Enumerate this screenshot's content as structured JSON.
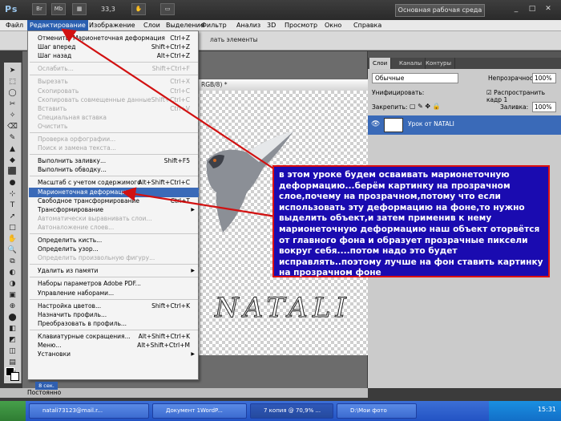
{
  "app": {
    "logo": "Ps",
    "zoom": "33,3",
    "workspace": "Основная рабочая среда"
  },
  "menubar": [
    {
      "label": "Файл",
      "active": false
    },
    {
      "label": "Редактирование",
      "active": true
    },
    {
      "label": "Изображение",
      "active": false
    },
    {
      "label": "Слои",
      "active": false
    },
    {
      "label": "Выделение",
      "active": false
    },
    {
      "label": "Фильтр",
      "active": false
    },
    {
      "label": "Анализ",
      "active": false
    },
    {
      "label": "3D",
      "active": false
    },
    {
      "label": "Просмотр",
      "active": false
    },
    {
      "label": "Окно",
      "active": false
    },
    {
      "label": "Справка",
      "active": false
    }
  ],
  "options": {
    "text": "лать элементы"
  },
  "edit_menu": [
    {
      "label": "Отменить: Марионеточная деформация",
      "shortcut": "Ctrl+Z",
      "state": "normal"
    },
    {
      "label": "Шаг вперед",
      "shortcut": "Shift+Ctrl+Z",
      "state": "normal"
    },
    {
      "label": "Шаг назад",
      "shortcut": "Alt+Ctrl+Z",
      "state": "normal"
    },
    {
      "sep": true
    },
    {
      "label": "Ослабить...",
      "shortcut": "Shift+Ctrl+F",
      "state": "disabled"
    },
    {
      "sep": true
    },
    {
      "label": "Вырезать",
      "shortcut": "Ctrl+X",
      "state": "disabled"
    },
    {
      "label": "Скопировать",
      "shortcut": "Ctrl+C",
      "state": "disabled"
    },
    {
      "label": "Скопировать совмещенные данные",
      "shortcut": "Shift+Ctrl+C",
      "state": "disabled"
    },
    {
      "label": "Вставить",
      "shortcut": "Ctrl+V",
      "state": "disabled"
    },
    {
      "label": "Специальная вставка",
      "shortcut": "",
      "state": "disabled"
    },
    {
      "label": "Очистить",
      "shortcut": "",
      "state": "disabled"
    },
    {
      "sep": true
    },
    {
      "label": "Проверка орфографии...",
      "shortcut": "",
      "state": "disabled"
    },
    {
      "label": "Поиск и замена текста...",
      "shortcut": "",
      "state": "disabled"
    },
    {
      "sep": true
    },
    {
      "label": "Выполнить заливку...",
      "shortcut": "Shift+F5",
      "state": "normal"
    },
    {
      "label": "Выполнить обводку...",
      "shortcut": "",
      "state": "normal"
    },
    {
      "sep": true
    },
    {
      "label": "Масштаб с учетом содержимого",
      "shortcut": "Alt+Shift+Ctrl+C",
      "state": "normal"
    },
    {
      "label": "Марионеточная деформация",
      "shortcut": "",
      "state": "highlighted"
    },
    {
      "label": "Свободное трансформирование",
      "shortcut": "Ctrl+T",
      "state": "normal"
    },
    {
      "label": "Трансформирование",
      "shortcut": "",
      "state": "normal",
      "submenu": true
    },
    {
      "label": "Автоматически выравнивать слои...",
      "shortcut": "",
      "state": "disabled"
    },
    {
      "label": "Автоналожение слоев...",
      "shortcut": "",
      "state": "disabled"
    },
    {
      "sep": true
    },
    {
      "label": "Определить кисть...",
      "shortcut": "",
      "state": "normal"
    },
    {
      "label": "Определить узор...",
      "shortcut": "",
      "state": "normal"
    },
    {
      "label": "Определить произвольную фигуру...",
      "shortcut": "",
      "state": "disabled"
    },
    {
      "sep": true
    },
    {
      "label": "Удалить из памяти",
      "shortcut": "",
      "state": "normal",
      "submenu": true
    },
    {
      "sep": true
    },
    {
      "label": "Наборы параметров Adobe PDF...",
      "shortcut": "",
      "state": "normal"
    },
    {
      "label": "Управление наборами...",
      "shortcut": "",
      "state": "normal"
    },
    {
      "sep": true
    },
    {
      "label": "Настройка цветов...",
      "shortcut": "Shift+Ctrl+K",
      "state": "normal"
    },
    {
      "label": "Назначить профиль...",
      "shortcut": "",
      "state": "normal"
    },
    {
      "label": "Преобразовать в профиль...",
      "shortcut": "",
      "state": "normal"
    },
    {
      "sep": true
    },
    {
      "label": "Клавиатурные сокращения...",
      "shortcut": "Alt+Shift+Ctrl+K",
      "state": "normal"
    },
    {
      "label": "Меню...",
      "shortcut": "Alt+Shift+Ctrl+M",
      "state": "normal"
    },
    {
      "label": "Установки",
      "shortcut": "",
      "state": "normal",
      "submenu": true
    }
  ],
  "document": {
    "title_fragment": "I, RGB/8) *",
    "watermark": "NATALI",
    "sub_label": "8 сек."
  },
  "panels": {
    "tabs": [
      {
        "label": "Слои",
        "on": true
      },
      {
        "label": "Каналы",
        "on": false
      },
      {
        "label": "Контуры",
        "on": false
      }
    ],
    "blend_mode": "Обычные",
    "opacity_label": "Непрозрачность:",
    "opacity_value": "100%",
    "unify_label": "Унифицировать:",
    "propagate_label": "Распространить кадр 1",
    "lock_label": "Закрепить:",
    "fill_label": "Заливка:",
    "fill_value": "100%",
    "layer_name": "Урок от NATALI"
  },
  "statusbar": {
    "text": "Постоянно"
  },
  "callout": {
    "text": "в этом уроке будем осваивать марионеточную деформацию...берём картинку на прозрачном слое,почему на прозрачном,потому что если использовать эту деформацию на фоне,то нужно выделить объект,и затем применив к нему марионеточную деформацию наш объект оторвётся от главного фона и образует прозрачные пиксели вокруг себя....потом надо это будет исправлять..поэтому лучше на фон ставить картинку на прозрачном фоне"
  },
  "taskbar": {
    "tasks": [
      {
        "label": "natali73123@mail.r...",
        "on": false
      },
      {
        "label": "Документ 1WordP...",
        "on": false
      },
      {
        "label": "7 копия @ 70,9% ...",
        "on": true
      },
      {
        "label": "D:\\Мои фото",
        "on": false
      }
    ],
    "clock": "15:31"
  },
  "colors": {
    "accent": "#3a6ab8",
    "callout_bg": "#1a0bb0",
    "callout_border": "#d11111",
    "arrow": "#d11111"
  }
}
